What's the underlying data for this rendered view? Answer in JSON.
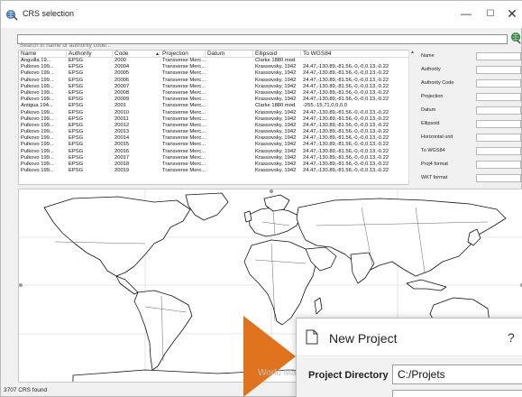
{
  "window": {
    "title": "CRS selection",
    "controls": {
      "minimize": "—",
      "maximize": "☐",
      "close": "✕"
    }
  },
  "search": {
    "placeholder": "Search in name or authority code...",
    "value": ""
  },
  "table": {
    "columns": [
      "Name",
      "Authority",
      "Code",
      "Projection",
      "Datum",
      "Ellipsoid",
      "To WGS84"
    ],
    "sort_indicator": "▲",
    "rows": [
      [
        "Anguilla 19...",
        "EPSG",
        "2000",
        "Transverse Merc...",
        "",
        "Clarke 1880 mod.",
        ""
      ],
      [
        "Pulkovo 199...",
        "EPSG",
        "20004",
        "Transverse Merc...",
        "",
        "Krassovsky, 1942",
        "24.47,-130.89,-81.56,-0,-0,0.13,-0.22"
      ],
      [
        "Pulkovo 199...",
        "EPSG",
        "20005",
        "Transverse Merc...",
        "",
        "Krassovsky, 1942",
        "24.47,-130.89,-81.56,-0,-0,0.13,-0.22"
      ],
      [
        "Pulkovo 199...",
        "EPSG",
        "20006",
        "Transverse Merc...",
        "",
        "Krassovsky, 1942",
        "24.47,-130.89,-81.56,-0,-0,0.13,-0.22"
      ],
      [
        "Pulkovo 199...",
        "EPSG",
        "20007",
        "Transverse Merc...",
        "",
        "Krassovsky, 1942",
        "24.47,-130.89,-81.56,-0,-0,0.13,-0.22"
      ],
      [
        "Pulkovo 199...",
        "EPSG",
        "20008",
        "Transverse Merc...",
        "",
        "Krassovsky, 1942",
        "24.47,-130.89,-81.56,-0,-0,0.13,-0.22"
      ],
      [
        "Pulkovo 199...",
        "EPSG",
        "20009",
        "Transverse Merc...",
        "",
        "Krassovsky, 1942",
        "24.47,-130.89,-81.56,-0,-0,0.13,-0.22"
      ],
      [
        "Antigua 194...",
        "EPSG",
        "2001",
        "Transverse Merc...",
        "",
        "Clarke 1880 mod.",
        "-255,-15,71,0,0,0,0"
      ],
      [
        "Pulkovo 199...",
        "EPSG",
        "20010",
        "Transverse Merc...",
        "",
        "Krassovsky, 1942",
        "24.47,-130.89,-81.56,-0,-0,0.13,-0.22"
      ],
      [
        "Pulkovo 199...",
        "EPSG",
        "20011",
        "Transverse Merc...",
        "",
        "Krassovsky, 1942",
        "24.47,-130.89,-81.56,-0,-0,0.13,-0.22"
      ],
      [
        "Pulkovo 199...",
        "EPSG",
        "20012",
        "Transverse Merc...",
        "",
        "Krassovsky, 1942",
        "24.47,-130.89,-81.56,-0,-0,0.13,-0.22"
      ],
      [
        "Pulkovo 199...",
        "EPSG",
        "20013",
        "Transverse Merc...",
        "",
        "Krassovsky, 1942",
        "24.47,-130.89,-81.56,-0,-0,0.13,-0.22"
      ],
      [
        "Pulkovo 199...",
        "EPSG",
        "20014",
        "Transverse Merc...",
        "",
        "Krassovsky, 1942",
        "24.47,-130.89,-81.56,-0,-0,0.13,-0.22"
      ],
      [
        "Pulkovo 199...",
        "EPSG",
        "20015",
        "Transverse Merc...",
        "",
        "Krassovsky, 1942",
        "24.47,-130.89,-81.56,-0,-0,0.13,-0.22"
      ],
      [
        "Pulkovo 199...",
        "EPSG",
        "20016",
        "Transverse Merc...",
        "",
        "Krassovsky, 1942",
        "24.47,-130.89,-81.56,-0,-0,0.13,-0.22"
      ],
      [
        "Pulkovo 199...",
        "EPSG",
        "20017",
        "Transverse Merc...",
        "",
        "Krassovsky, 1942",
        "24.47,-130.89,-81.56,-0,-0,0.13,-0.22"
      ],
      [
        "Pulkovo 199...",
        "EPSG",
        "20018",
        "Transverse Merc...",
        "",
        "Krassovsky, 1942",
        "24.47,-130.89,-81.56,-0,-0,0.13,-0.22"
      ],
      [
        "Pulkovo 199...",
        "EPSG",
        "20019",
        "Transverse Merc...",
        "",
        "Krassovsky, 1942",
        "24.47,-130.89,-81.56,-0,-0,0.13,-0.22"
      ]
    ]
  },
  "properties": {
    "labels": [
      "Name",
      "Authority",
      "Authority Code",
      "Projection",
      "Datum",
      "Ellipsoid",
      "Horizontal unit",
      "To WGS84",
      "Proj4 format",
      "WKT format"
    ]
  },
  "status": {
    "count_text": "3707 CRS found"
  },
  "overlay": {
    "watermark": "World Map",
    "dialog": {
      "title": "New Project",
      "help": "?",
      "directory_label": "Project Directory",
      "directory_value": "C:/Projets"
    },
    "colors": {
      "arrow": "#e0731e"
    }
  },
  "colors": {
    "filter_icon": "#2f7d3a",
    "app_icon": "#3a6ea5"
  }
}
